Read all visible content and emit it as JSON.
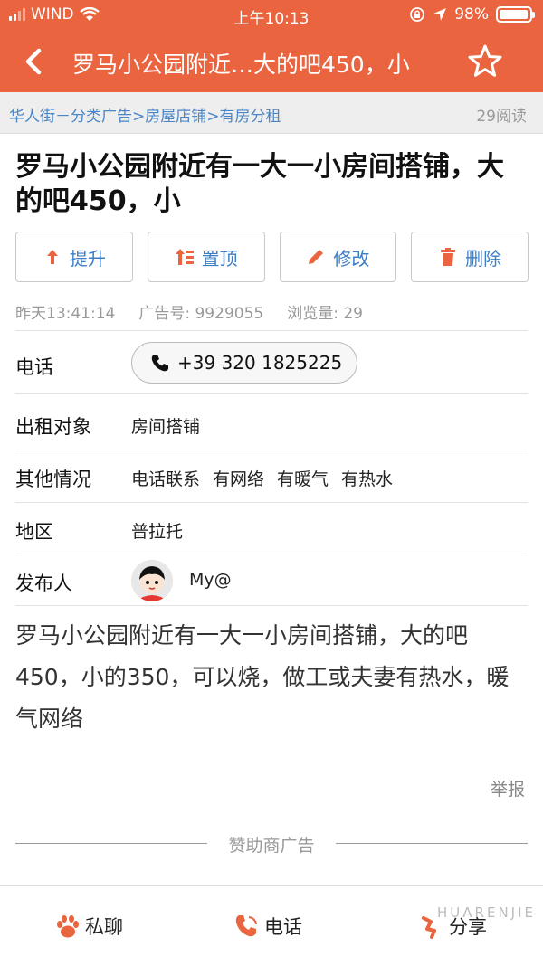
{
  "status_bar": {
    "carrier": "WIND",
    "time": "上午10:13",
    "battery": "98%",
    "battery_level": 0.98
  },
  "nav": {
    "title": "罗马小公园附近…大的吧450，小",
    "back_icon": "chevron-left-icon",
    "favorite_icon": "star-icon"
  },
  "breadcrumb": {
    "path": "华人街－分类广告>房屋店铺>有房分租",
    "reads": "29阅读"
  },
  "headline": "罗马小公园附近有一大一小房间搭铺，大的吧450，小",
  "actions": [
    {
      "label": "提升",
      "icon": "arrow-up-icon"
    },
    {
      "label": "置顶",
      "icon": "pin-top-icon"
    },
    {
      "label": "修改",
      "icon": "pencil-icon"
    },
    {
      "label": "删除",
      "icon": "trash-icon"
    }
  ],
  "meta": {
    "time": "昨天13:41:14",
    "ad_no": "广告号: 9929055",
    "views": "浏览量: 29"
  },
  "details": {
    "phone_label": "电话",
    "phone_value": "+39 320 1825225",
    "target_label": "出租对象",
    "target_value": "房间搭铺",
    "other_label": "其他情况",
    "other_tags": [
      "电话联系",
      "有网络",
      "有暖气",
      "有热水"
    ],
    "area_label": "地区",
    "area_value": "普拉托",
    "poster_label": "发布人",
    "poster_name": "My@"
  },
  "description": "罗马小公园附近有一大一小房间搭铺，大的吧450，小的350，可以烧，做工或夫妻有热水，暖气网络",
  "report": "举报",
  "sponsor": "赞助商广告",
  "tabbar": {
    "chat": "私聊",
    "call": "电话",
    "share": "分享"
  },
  "watermark": "HUARENJIE",
  "colors": {
    "brand": "#e9643f",
    "link": "#3d7dc4"
  }
}
